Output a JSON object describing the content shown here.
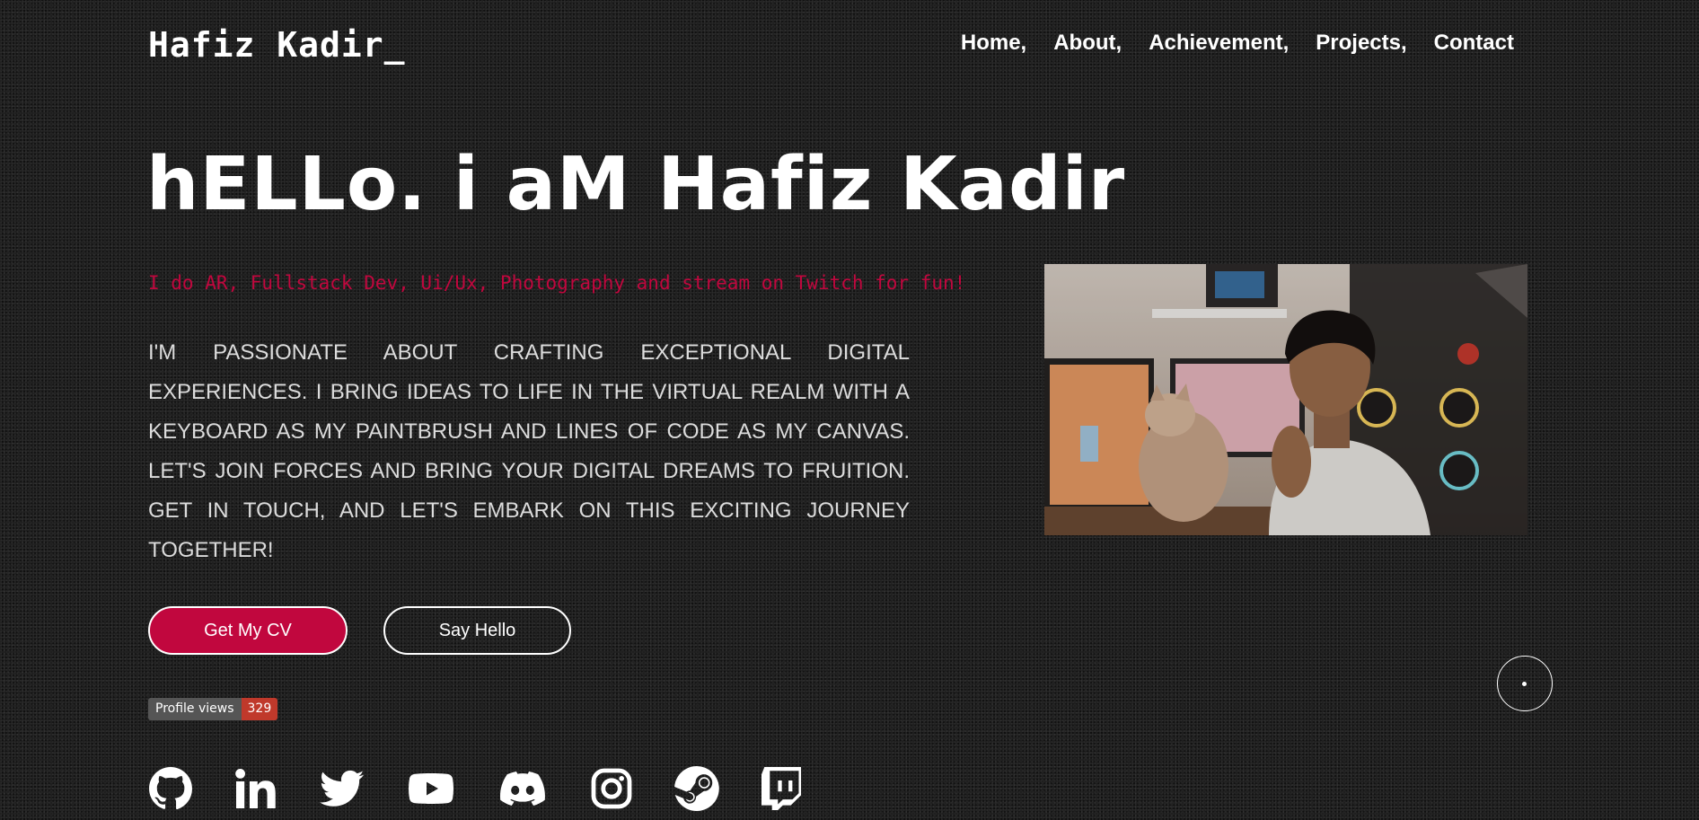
{
  "header": {
    "logo": "Hafiz Kadir_",
    "nav": [
      "Home,",
      "About,",
      "Achievement,",
      "Projects,",
      "Contact"
    ]
  },
  "hero": {
    "title": "hELLo. i aM Hafiz Kadir",
    "tagline": "I do AR, Fullstack Dev, Ui/Ux, Photography and stream on Twitch for fun!",
    "bio": "I'm passionate about crafting exceptional digital experiences. I bring ideas to life in the virtual realm with a keyboard as my paintbrush and lines of code as my canvas. Let's join forces and bring your digital dreams to fruition. Get in touch, and let's embark on this exciting journey together!",
    "cv_button": "Get My CV",
    "hello_button": "Say Hello"
  },
  "profile_views": {
    "label": "Profile views",
    "count": "329"
  },
  "socials": [
    "github-icon",
    "linkedin-icon",
    "twitter-icon",
    "youtube-icon",
    "discord-icon",
    "instagram-icon",
    "steam-icon",
    "twitch-icon"
  ],
  "colors": {
    "accent": "#c1073e",
    "background": "#1c1c1c",
    "text": "#ffffff"
  }
}
